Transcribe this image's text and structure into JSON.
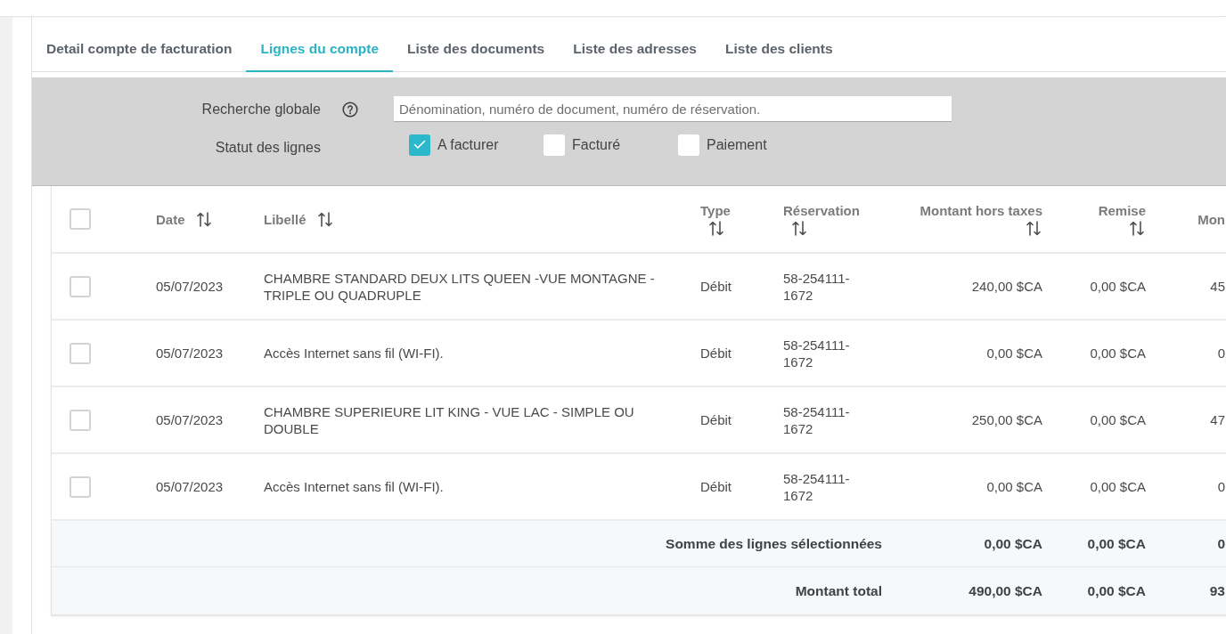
{
  "tabs": [
    {
      "label": "Detail compte de facturation",
      "selected": false
    },
    {
      "label": "Lignes du compte",
      "selected": true
    },
    {
      "label": "Liste des documents",
      "selected": false
    },
    {
      "label": "Liste des adresses",
      "selected": false
    },
    {
      "label": "Liste des clients",
      "selected": false
    }
  ],
  "filters": {
    "search": {
      "label": "Recherche globale",
      "placeholder": "Dénomination, numéro de document, numéro de réservation."
    },
    "status": {
      "label": "Statut des lignes",
      "options": [
        {
          "label": "A facturer",
          "checked": true
        },
        {
          "label": "Facturé",
          "checked": false
        },
        {
          "label": "Paiement",
          "checked": false
        }
      ]
    }
  },
  "table": {
    "select_all": {
      "checked": false
    },
    "columns": [
      {
        "label": "Date",
        "sortable": true
      },
      {
        "label": "Libellé",
        "sortable": true
      },
      {
        "label": "Type",
        "sortable": true
      },
      {
        "label": "Réservation",
        "sortable": true
      },
      {
        "label": "Montant hors taxes",
        "sortable": true
      },
      {
        "label": "Remise",
        "sortable": true
      },
      {
        "label": "Mon",
        "sortable": false
      }
    ],
    "rows": [
      {
        "checked": false,
        "cells": [
          "05/07/2023",
          "CHAMBRE STANDARD DEUX LITS QUEEN -VUE MONTAGNE - TRIPLE OU QUADRUPLE",
          "Débit",
          "58-254111-1672",
          "240,00 $CA",
          "0,00 $CA",
          "45"
        ]
      },
      {
        "checked": false,
        "cells": [
          "05/07/2023",
          "Accès Internet sans fil (WI-FI).",
          "Débit",
          "58-254111-1672",
          "0,00 $CA",
          "0,00 $CA",
          "0"
        ]
      },
      {
        "checked": false,
        "cells": [
          "05/07/2023",
          "CHAMBRE SUPERIEURE LIT KING - VUE LAC - SIMPLE OU DOUBLE",
          "Débit",
          "58-254111-1672",
          "250,00 $CA",
          "0,00 $CA",
          "47"
        ]
      },
      {
        "checked": false,
        "cells": [
          "05/07/2023",
          "Accès Internet sans fil (WI-FI).",
          "Débit",
          "58-254111-1672",
          "0,00 $CA",
          "0,00 $CA",
          "0"
        ]
      }
    ],
    "summary_rows": [
      {
        "label": "Somme des lignes sélectionnées",
        "cells": [
          "0,00 $CA",
          "0,00 $CA",
          "0"
        ]
      },
      {
        "label": "Montant total",
        "cells": [
          "490,00 $CA",
          "0,00 $CA",
          "93"
        ]
      }
    ]
  }
}
